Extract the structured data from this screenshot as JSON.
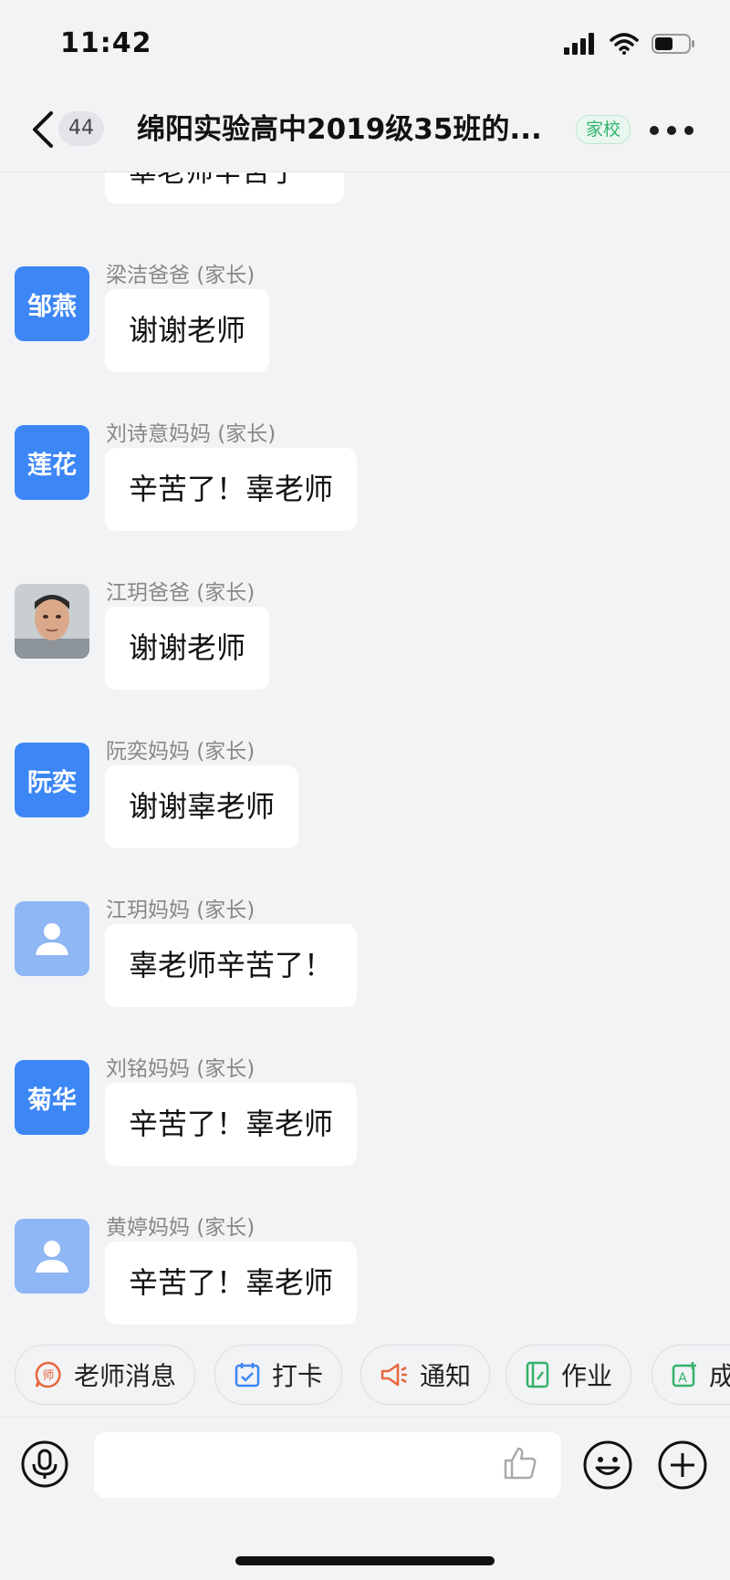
{
  "status_bar": {
    "time": "11:42"
  },
  "header": {
    "unread_count": "44",
    "title": "绵阳实验高中2019级35班的...",
    "tag": "家校"
  },
  "partial_message": {
    "text": "辜老师辛苦了"
  },
  "messages": [
    {
      "sender": "梁洁爸爸 (家长)",
      "avatar_text": "邹燕",
      "avatar_style": "blue",
      "text": "谢谢老师"
    },
    {
      "sender": "刘诗意妈妈 (家长)",
      "avatar_text": "莲花",
      "avatar_style": "blue",
      "text": "辛苦了！辜老师"
    },
    {
      "sender": "江玥爸爸 (家长)",
      "avatar_text": "",
      "avatar_style": "photo",
      "text": "谢谢老师"
    },
    {
      "sender": "阮奕妈妈 (家长)",
      "avatar_text": "阮奕",
      "avatar_style": "blue",
      "text": "谢谢辜老师"
    },
    {
      "sender": "江玥妈妈 (家长)",
      "avatar_text": "",
      "avatar_style": "default",
      "text": "辜老师辛苦了！"
    },
    {
      "sender": "刘铭妈妈 (家长)",
      "avatar_text": "菊华",
      "avatar_style": "blue",
      "text": "辛苦了！辜老师"
    },
    {
      "sender": "黄婷妈妈 (家长)",
      "avatar_text": "",
      "avatar_style": "default",
      "text": "辛苦了！辜老师"
    }
  ],
  "quick_actions": [
    {
      "label": "老师消息",
      "icon": "teacher-message-icon"
    },
    {
      "label": "打卡",
      "icon": "check-in-icon"
    },
    {
      "label": "通知",
      "icon": "megaphone-icon"
    },
    {
      "label": "作业",
      "icon": "homework-icon"
    },
    {
      "label": "成",
      "icon": "grade-icon"
    }
  ],
  "input_bar": {
    "placeholder": ""
  },
  "colors": {
    "accent_blue": "#3c86f5",
    "tag_green": "#2fb36d",
    "background": "#f2f3f5"
  }
}
